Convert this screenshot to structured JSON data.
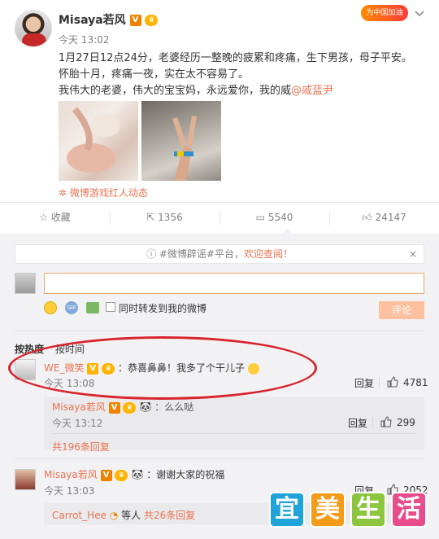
{
  "post": {
    "author": "Misaya若风",
    "time": "今天 13:02",
    "text_lines": [
      "1月27日12点24分，老婆经历一整晚的疲累和疼痛，生下男孩，母子平安。",
      "怀胎十月，疼痛一夜，实在太不容易了。",
      "我伟大的老婆，伟大的宝宝妈，永远爱你，我的威"
    ],
    "mention": "@戚蓝尹",
    "source": "微博游戏红人动态",
    "promo_badge": "为中国加油"
  },
  "actions": {
    "collect": "收藏",
    "forward": "1356",
    "comment": "5540",
    "like": "24147"
  },
  "notice": {
    "prefix": "#微博辟谣#平台，",
    "highlight": "欢迎查阅！",
    "close": "×"
  },
  "composer": {
    "checkbox_label": "同时转发到我的微博",
    "submit": "评论"
  },
  "sort": {
    "hot": "按热度",
    "time": "按时间"
  },
  "comments": [
    {
      "name": "WE_微笑",
      "text": "：恭喜鼻鼻！我多了个干儿子",
      "time": "今天 13:08",
      "reply": "回复",
      "likes": "4781",
      "sub": {
        "name": "Misaya若风",
        "text": "：么么哒",
        "time": "今天 13:12",
        "reply": "回复",
        "likes": "299"
      },
      "more": "共196条回复"
    },
    {
      "name": "Misaya若风",
      "text": "：谢谢大家的祝福",
      "time": "今天 13:03",
      "reply": "回复",
      "likes": "2052",
      "sub": {
        "name": "Carrot_Hee",
        "text": "等人",
        "more": "共26条回复"
      }
    }
  ],
  "watermark": [
    "宜",
    "美",
    "生",
    "活"
  ],
  "colors": {
    "accent": "#eb7350",
    "ellipse": "#d9232d",
    "submit": "#ffc09f"
  }
}
